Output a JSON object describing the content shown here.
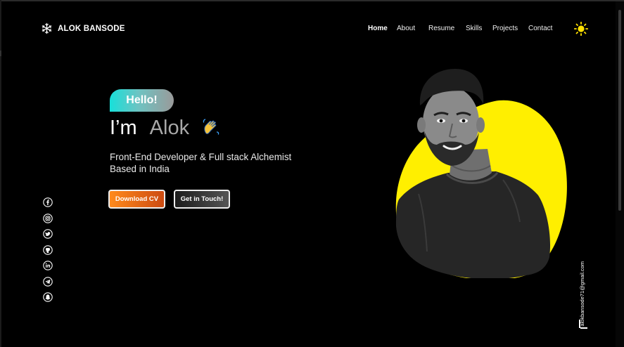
{
  "brand": {
    "name": "ALOK BANSODE",
    "logo_icon": "snowflake-logo-icon"
  },
  "nav": {
    "items": [
      {
        "label": "Home",
        "active": true
      },
      {
        "label": "About",
        "active": false
      },
      {
        "label": "Resume",
        "active": false
      },
      {
        "label": "Skills",
        "active": false
      },
      {
        "label": "Projects",
        "active": false
      },
      {
        "label": "Contact",
        "active": false
      }
    ],
    "theme_toggle_icon": "sun-icon"
  },
  "hero": {
    "badge": "Hello!",
    "greeting_prefix": "I’m",
    "greeting_name": "Alok",
    "greeting_emoji": "waving-hand-icon",
    "tagline_line1": "Front-End Developer & Full stack Alchemist",
    "tagline_line2": "Based in India",
    "cta_download": "Download CV",
    "cta_contact": "Get in Touch!"
  },
  "social_icons": [
    "facebook-icon",
    "instagram-icon",
    "twitter-icon",
    "github-icon",
    "linkedin-icon",
    "telegram-icon",
    "snapchat-icon"
  ],
  "side_email": "alokbansode71@gmail.com",
  "colors": {
    "background": "#000000",
    "accent_yellow": "#ffef00",
    "accent_orange": "#ff8a1c",
    "accent_teal": "#17e0da"
  }
}
